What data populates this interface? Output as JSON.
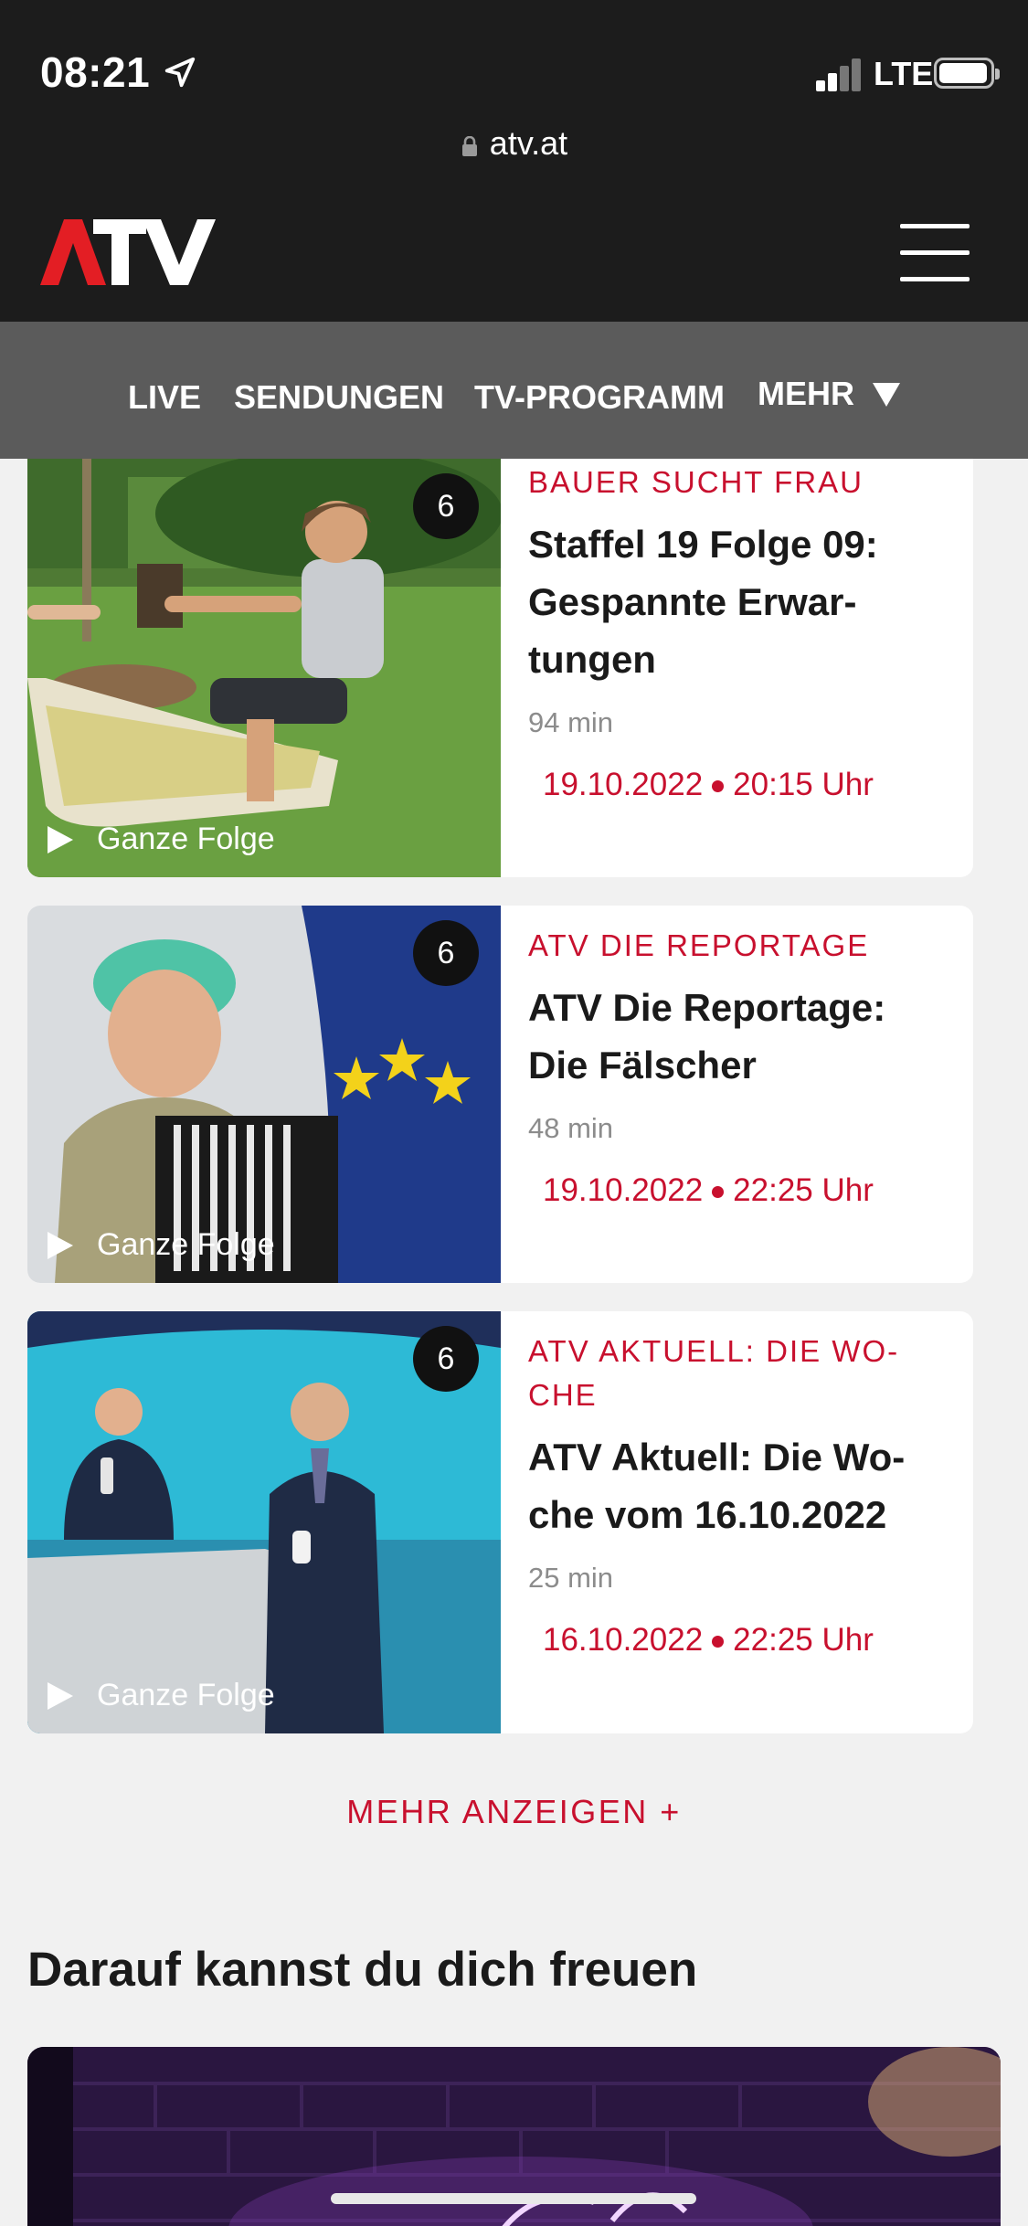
{
  "status_bar": {
    "time": "08:21",
    "network": "LTE"
  },
  "browser": {
    "url": "atv.at"
  },
  "header": {
    "logo_text": "ATV",
    "brand_color": "#e31e24"
  },
  "nav": {
    "live": "LIVE",
    "sendungen": "SENDUNGEN",
    "tv_programm": "TV-PROGRAMM",
    "mehr": "MEHR"
  },
  "cards": [
    {
      "category": "BAUER SUCHT FRAU",
      "title": "Staffel 19 Folge 09: Gespannte Erwar-tungen",
      "title_lines": [
        "Staffel 19 Folge 09:",
        "Gespannte Erwar-",
        "tungen"
      ],
      "duration": "94 min",
      "date": "19.10.2022",
      "time": "20:15 Uhr",
      "age_rating": "6",
      "play_label": "Ganze Folge"
    },
    {
      "category": "ATV DIE REPORTAGE",
      "title": "ATV Die Reportage: Die Fälscher",
      "title_lines": [
        "ATV Die Reportage:",
        "Die Fälscher"
      ],
      "duration": "48 min",
      "date": "19.10.2022",
      "time": "22:25 Uhr",
      "age_rating": "6",
      "play_label": "Ganze Folge"
    },
    {
      "category": "ATV AKTUELL: DIE WO-CHE",
      "category_lines": [
        "ATV AKTUELL: DIE WO-",
        "CHE"
      ],
      "title": "ATV Aktuell: Die Wo-che vom 16.10.2022",
      "title_lines": [
        "ATV Aktuell: Die Wo-",
        "che vom 16.10.2022"
      ],
      "duration": "25 min",
      "date": "16.10.2022",
      "time": "22:25 Uhr",
      "age_rating": "6",
      "play_label": "Ganze Folge"
    }
  ],
  "more_button": "MEHR ANZEIGEN +",
  "section": {
    "title": "Darauf kannst du dich freuen"
  },
  "colors": {
    "accent": "#c8102e",
    "header_bg": "#1c1c1c",
    "nav_bg": "#5b5b5b",
    "page_bg": "#f1f1f1"
  }
}
